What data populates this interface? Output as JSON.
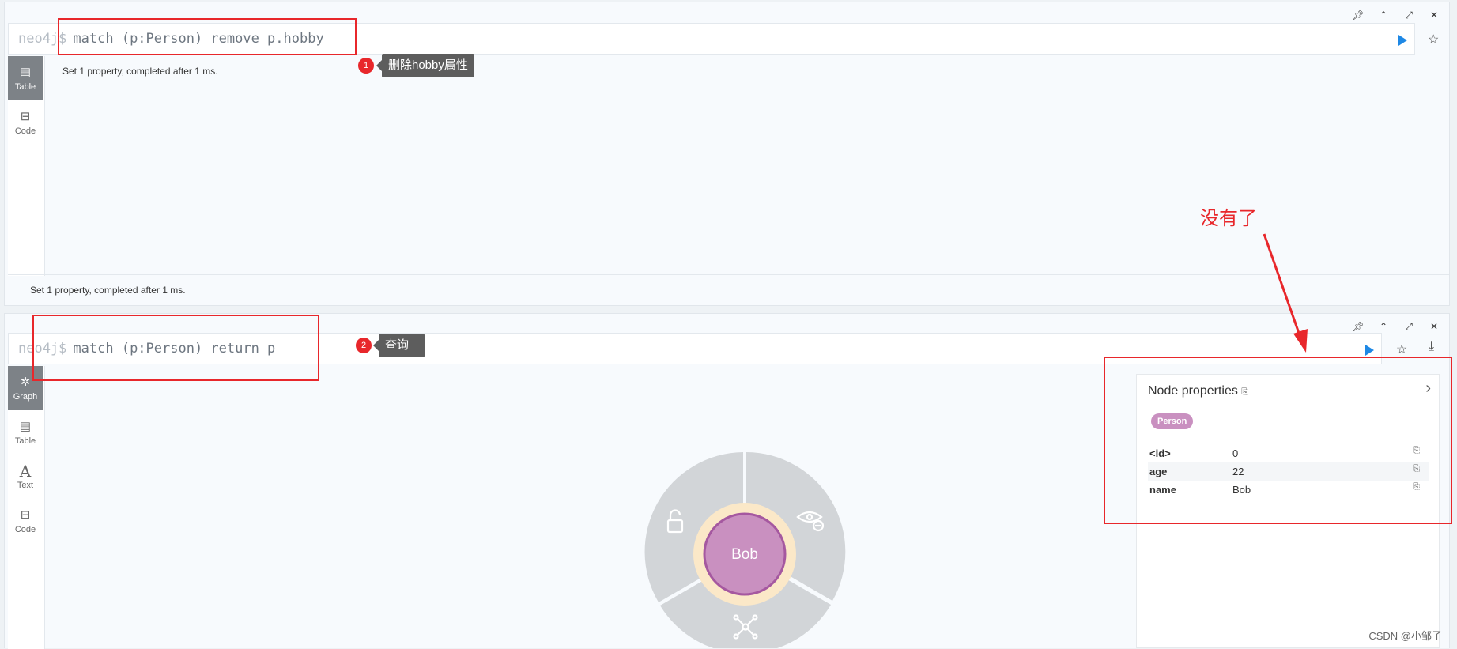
{
  "frame1": {
    "prompt": "neo4j$",
    "query": "match (p:Person) remove p.hobby",
    "sidebar": [
      {
        "label": "Table",
        "active": true
      },
      {
        "label": "Code",
        "active": false
      }
    ],
    "result_message": "Set 1 property, completed after 1 ms.",
    "footer_status": "Set 1 property, completed after 1 ms."
  },
  "frame2": {
    "prompt": "neo4j$",
    "query": "match (p:Person) return p",
    "sidebar": [
      {
        "label": "Graph",
        "active": true
      },
      {
        "label": "Table",
        "active": false
      },
      {
        "label": "Text",
        "active": false
      },
      {
        "label": "Code",
        "active": false
      }
    ],
    "node_caption": "Bob",
    "node_color": "#c990c0",
    "node_border": "#a558a0",
    "properties_panel": {
      "title": "Node properties",
      "label": "Person",
      "rows": [
        {
          "key": "<id>",
          "value": "0"
        },
        {
          "key": "age",
          "value": "22"
        },
        {
          "key": "name",
          "value": "Bob"
        }
      ]
    }
  },
  "annotations": {
    "step1_number": "1",
    "step1_text": "删除hobby属性",
    "step2_number": "2",
    "step2_text": "查询",
    "gone_text": "没有了",
    "color": "#e8272b"
  },
  "icons": [
    "pin-icon",
    "collapse-icon",
    "expand-icon",
    "close-icon",
    "run-icon",
    "star-icon",
    "download-icon",
    "table-icon",
    "code-icon",
    "graph-icon",
    "text-icon",
    "unlock-icon",
    "hide-icon",
    "expand-graph-icon",
    "copy-icon",
    "chevron-right-icon"
  ],
  "accent_color": "#1e88e5",
  "watermark": "CSDN @小邹子"
}
